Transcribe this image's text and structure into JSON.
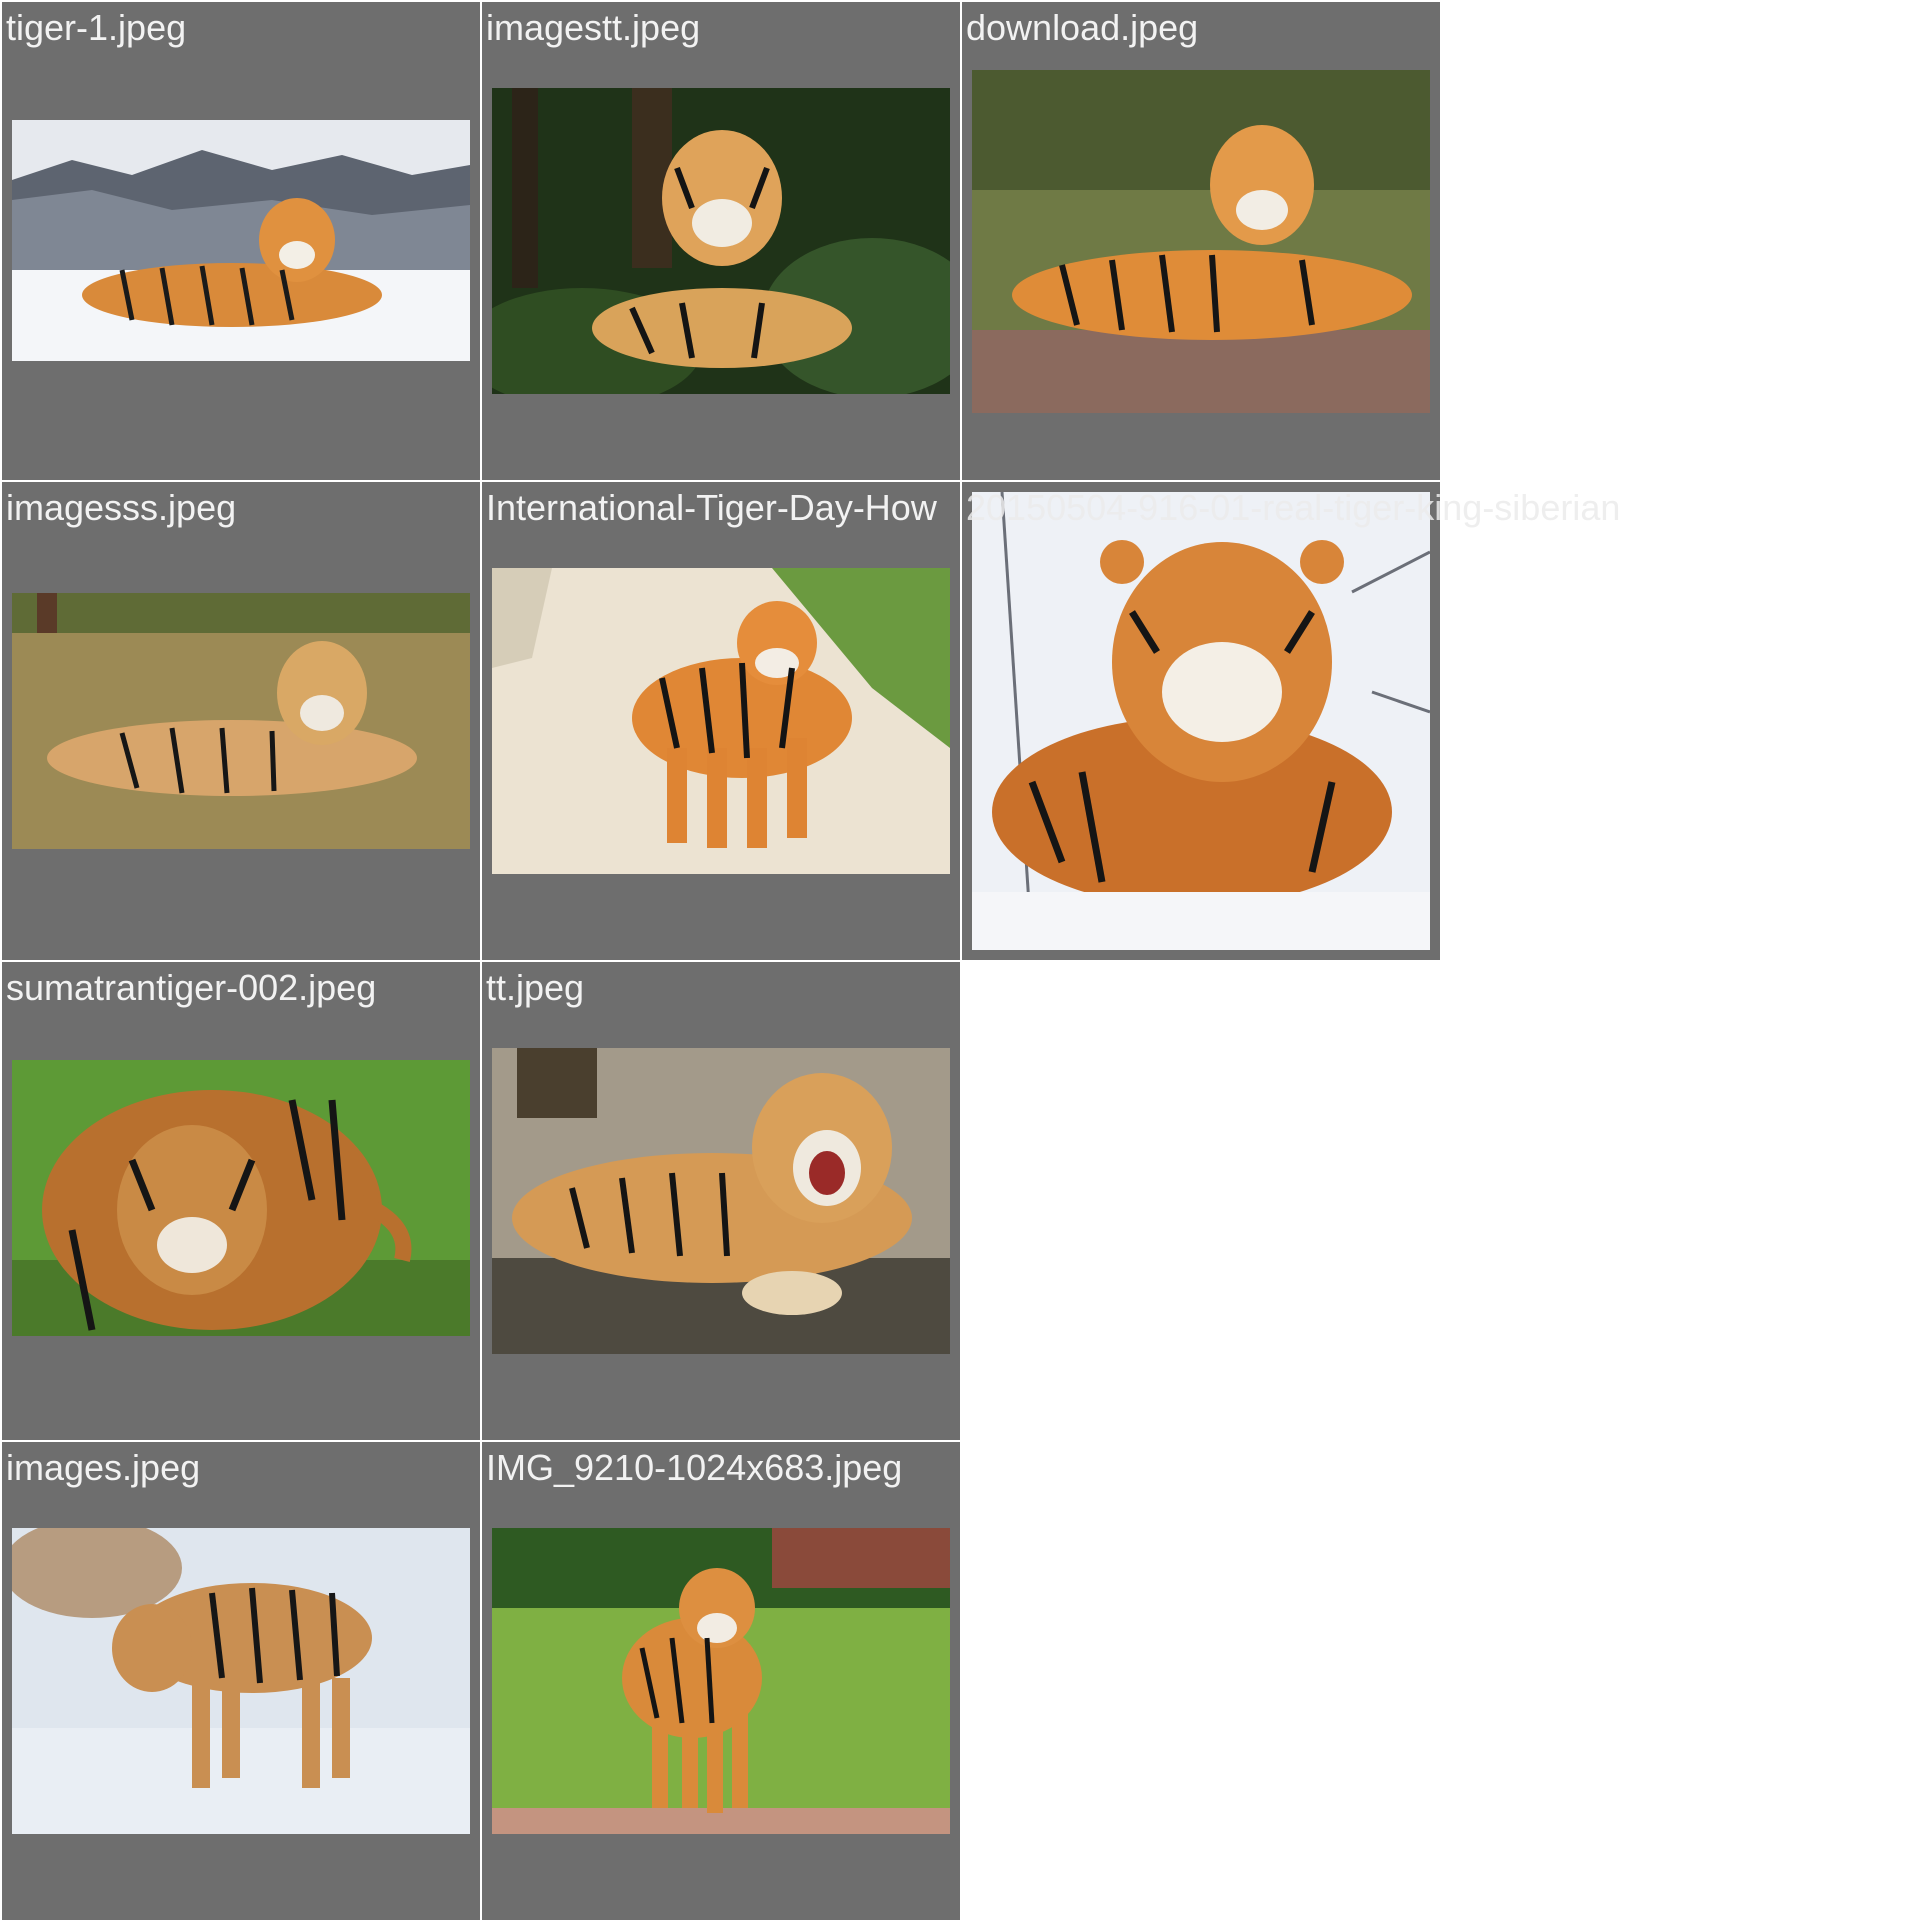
{
  "gallery": {
    "tiles": [
      {
        "filename": "tiger-1.jpeg",
        "scene": "tiger lying on snow with mountains"
      },
      {
        "filename": "imagestt.jpeg",
        "scene": "tiger lying in green forest"
      },
      {
        "filename": "download.jpeg",
        "scene": "tiger lying on dry grass"
      },
      {
        "filename": "imagesss.jpeg",
        "scene": "tiger lying on grassy ground"
      },
      {
        "filename": "International-Tiger-Day-How",
        "scene": "tiger walking on sandy path"
      },
      {
        "filename": "20150504-916-01-real-tiger-king-siberian",
        "scene": "siberian tiger lying in snow"
      },
      {
        "filename": "sumatrantiger-002.jpeg",
        "scene": "sumatran tiger in green grass"
      },
      {
        "filename": "tt.jpeg",
        "scene": "tiger roaring on log"
      },
      {
        "filename": "images.jpeg",
        "scene": "tiger walking on snow"
      },
      {
        "filename": "IMG_9210-1024x683.jpeg",
        "scene": "tiger standing on green lawn"
      }
    ]
  }
}
